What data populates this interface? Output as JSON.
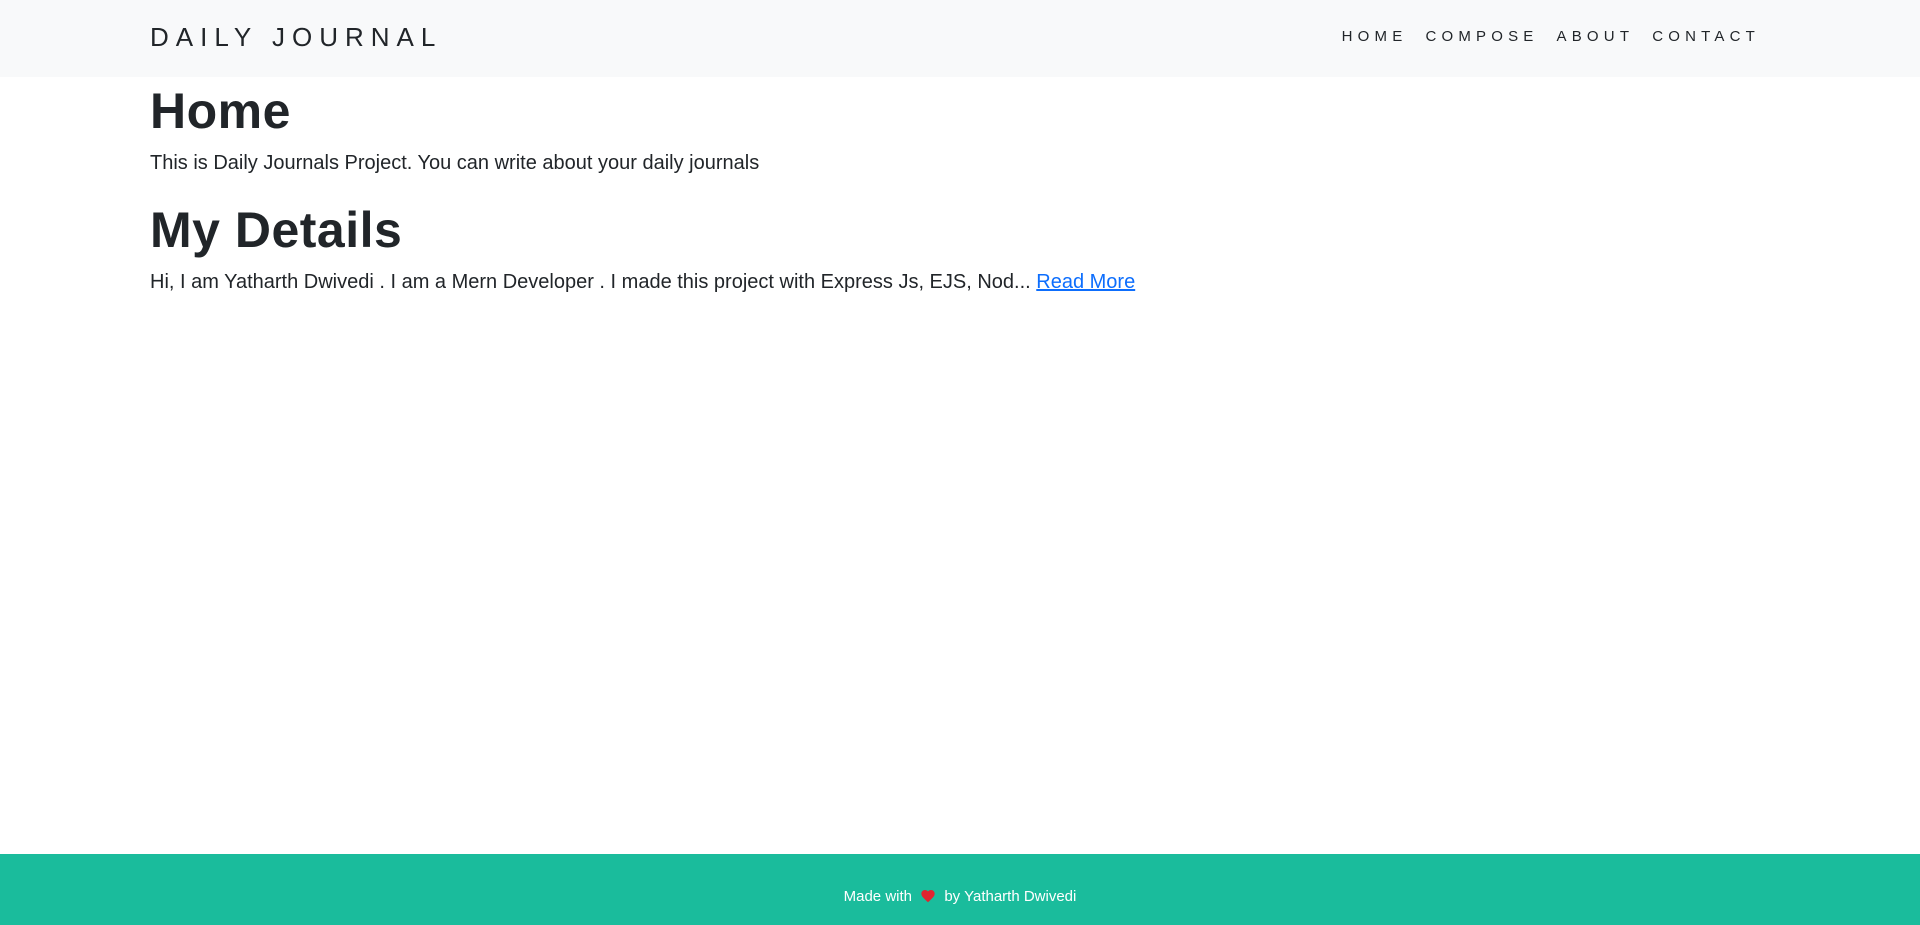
{
  "navbar": {
    "brand": "DAILY JOURNAL",
    "links": [
      "HOME",
      "COMPOSE",
      "ABOUT",
      "CONTACT"
    ]
  },
  "home": {
    "title": "Home",
    "intro": "This is Daily Journals Project. You can write about your daily journals"
  },
  "posts": [
    {
      "title": "My Details",
      "excerpt": "Hi, I am Yatharth Dwivedi . I am a Mern Developer . I made this project with Express Js, EJS, Nod...",
      "read_more": "Read More"
    }
  ],
  "footer": {
    "prefix": "Made with",
    "icon": "heart-icon",
    "suffix": "by Yatharth Dwivedi",
    "bg_color": "#1abc9c",
    "heart_color": "#e0242f"
  },
  "colors": {
    "navbar_bg": "#f8f9fa",
    "link": "#0d6efd",
    "text": "#212529"
  }
}
